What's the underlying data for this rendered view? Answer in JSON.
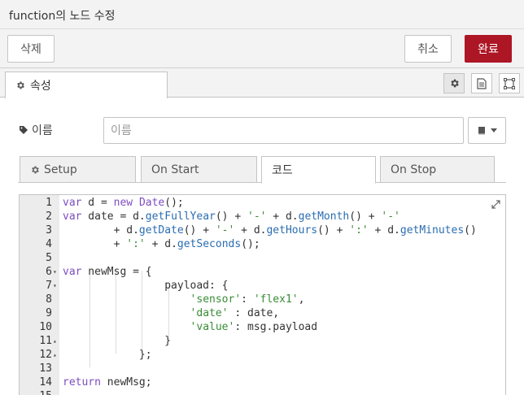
{
  "title": "function의 노드 수정",
  "toolbar": {
    "delete_label": "삭제",
    "cancel_label": "취소",
    "done_label": "완료"
  },
  "main_tab": {
    "label": "속성"
  },
  "name_field": {
    "label": "이름",
    "placeholder": "이름",
    "value": ""
  },
  "subtabs": [
    {
      "label": "Setup"
    },
    {
      "label": "On Start"
    },
    {
      "label": "코드"
    },
    {
      "label": "On Stop"
    }
  ],
  "editor": {
    "lines": [
      {
        "n": "1",
        "fold": ""
      },
      {
        "n": "2",
        "fold": ""
      },
      {
        "n": "3",
        "fold": ""
      },
      {
        "n": "4",
        "fold": ""
      },
      {
        "n": "5",
        "fold": ""
      },
      {
        "n": "6",
        "fold": "▾"
      },
      {
        "n": "7",
        "fold": "▾"
      },
      {
        "n": "8",
        "fold": ""
      },
      {
        "n": "9",
        "fold": ""
      },
      {
        "n": "10",
        "fold": ""
      },
      {
        "n": "11",
        "fold": "▴"
      },
      {
        "n": "12",
        "fold": "▴"
      },
      {
        "n": "13",
        "fold": ""
      },
      {
        "n": "14",
        "fold": ""
      },
      {
        "n": "15",
        "fold": ""
      }
    ],
    "code": [
      "var d = new Date();",
      "var date = d.getFullYear() + '-' + d.getMonth() + '-'",
      "        + d.getDate() + '-' + d.getHours() + ':' + d.getMinutes()",
      "        + ':' + d.getSeconds();",
      "",
      "var newMsg = {",
      "                payload: {",
      "                    'sensor': 'flex1',",
      "                    'date' : date,",
      "                    'value': msg.payload",
      "                }",
      "            };",
      "",
      "return newMsg;",
      ""
    ]
  },
  "icons": {
    "gear": "gear-icon",
    "tag": "tag-icon",
    "book": "book-icon",
    "document": "document-icon",
    "frame": "frame-icon",
    "expand": "expand-icon"
  },
  "colors": {
    "primary": "#ad1625",
    "keyword": "#7d4dbf",
    "string": "#3a8c36",
    "function": "#2b6db0"
  }
}
